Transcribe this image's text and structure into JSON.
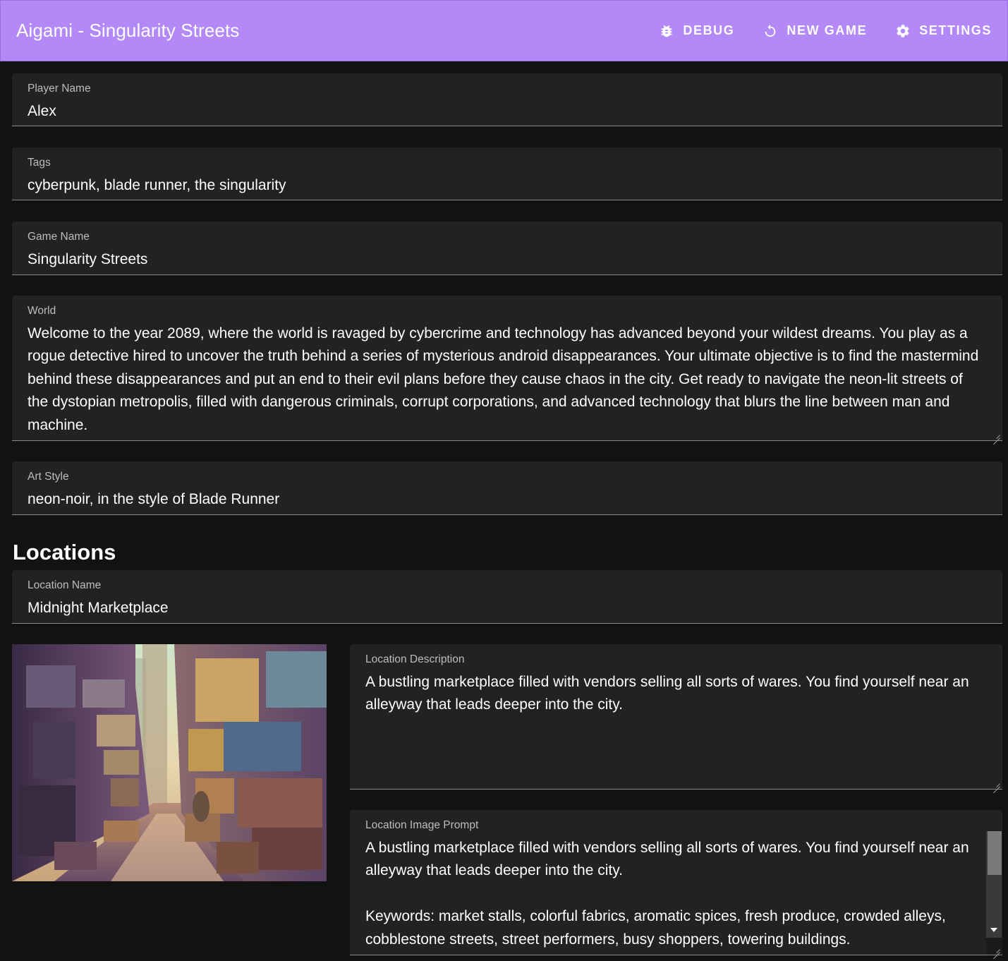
{
  "header": {
    "title": "Aigami - Singularity Streets",
    "actions": [
      {
        "label": "DEBUG",
        "icon": "bug-icon"
      },
      {
        "label": "NEW GAME",
        "icon": "restart-icon"
      },
      {
        "label": "SETTINGS",
        "icon": "gear-icon"
      }
    ],
    "background_color": "#b388f7"
  },
  "fields": {
    "player_name": {
      "label": "Player Name",
      "value": "Alex"
    },
    "tags": {
      "label": "Tags",
      "value": "cyberpunk, blade runner, the singularity"
    },
    "game_name": {
      "label": "Game Name",
      "value": "Singularity Streets"
    },
    "world": {
      "label": "World",
      "value": "Welcome to the year 2089, where the world is ravaged by cybercrime and technology has advanced beyond your wildest dreams. You play as a rogue detective hired to uncover the truth behind a series of mysterious android disappearances. Your ultimate objective is to find the mastermind behind these disappearances and put an end to their evil plans before they cause chaos in the city. Get ready to navigate the neon-lit streets of the dystopian metropolis, filled with dangerous criminals, corrupt corporations, and advanced technology that blurs the line between man and machine."
    },
    "art_style": {
      "label": "Art Style",
      "value": "neon-noir, in the style of Blade Runner"
    }
  },
  "locations": {
    "heading": "Locations",
    "location_name": {
      "label": "Location Name",
      "value": "Midnight Marketplace"
    },
    "location_description": {
      "label": "Location Description",
      "value": "A bustling marketplace filled with vendors selling all sorts of wares. You find yourself near an alleyway that leads deeper into the city."
    },
    "location_image_prompt": {
      "label": "Location Image Prompt",
      "value": "A bustling marketplace filled with vendors selling all sorts of wares. You find yourself near an alleyway that leads deeper into the city.\n\nKeywords: market stalls, colorful fabrics, aromatic spices, fresh produce, crowded alleys, cobblestone streets, street performers, busy shoppers, towering buildings."
    },
    "image": {
      "subject": "cyberpunk alley marketplace illustration"
    }
  }
}
